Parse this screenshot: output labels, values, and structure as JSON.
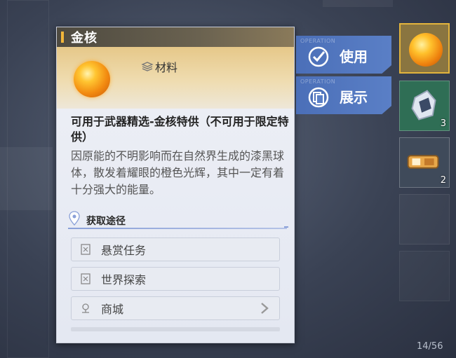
{
  "panel": {
    "title": "金核",
    "category": "材料",
    "description_title": "可用于武器精选-金核特供（不可用于限定特供）",
    "description_body": "因原能的不明影响而在自然界生成的漆黑球体，散发着耀眼的橙色光辉，其中一定有着十分强大的能量。",
    "source_header": "获取途径",
    "sources": [
      {
        "label": "悬赏任务",
        "icon": "scroll-icon"
      },
      {
        "label": "世界探索",
        "icon": "scroll-icon"
      },
      {
        "label": "商城",
        "icon": "shop-icon"
      }
    ]
  },
  "actions": {
    "use": {
      "tag": "OPERATION",
      "label": "使用",
      "icon": "check-icon"
    },
    "display": {
      "tag": "OPERATION",
      "label": "展示",
      "icon": "cards-icon"
    }
  },
  "inventory": {
    "slots": [
      {
        "item": "gold-core",
        "count": ""
      },
      {
        "item": "crystal",
        "count": "3"
      },
      {
        "item": "gear-part",
        "count": "2"
      }
    ],
    "page_counter": "14/56"
  },
  "colors": {
    "accent_gold": "#f2b63a",
    "action_blue": "#4b6fb8",
    "slot_green": "#2f6e55"
  }
}
